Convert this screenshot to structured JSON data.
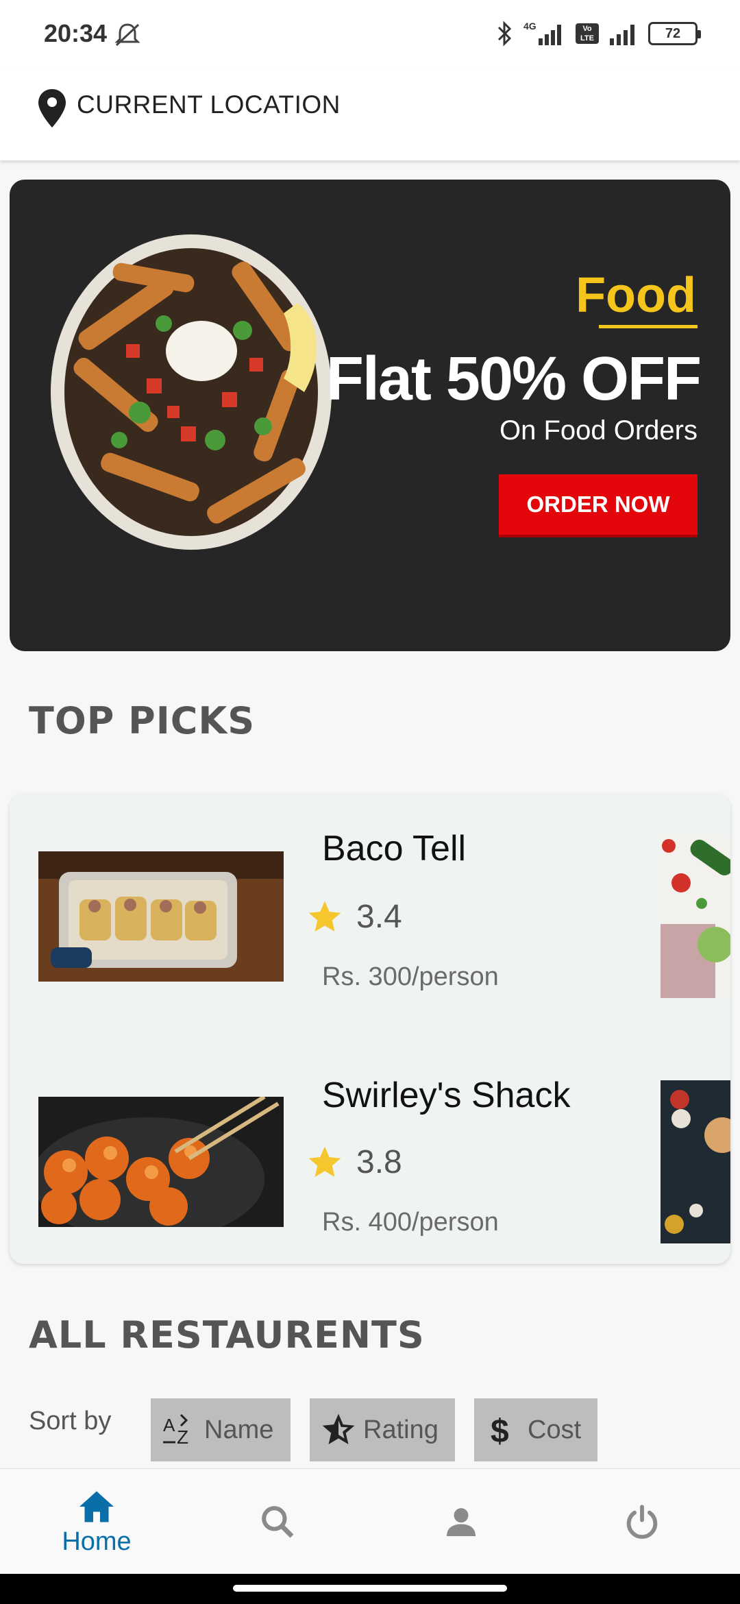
{
  "status_bar": {
    "time": "20:34",
    "network_1": "4G",
    "network_2": "Vo LTE",
    "battery": "72"
  },
  "header": {
    "location_label": "CURRENT LOCATION"
  },
  "banner": {
    "brand": "Food",
    "headline": "Flat 50% OFF",
    "subline": "On Food Orders",
    "cta": "ORDER NOW"
  },
  "top_picks": {
    "title": "TOP PICKS",
    "items": [
      {
        "name": "Baco Tell",
        "rating": "3.4",
        "cost": "Rs. 300/person"
      },
      {
        "name": "Swirley's Shack",
        "rating": "3.8",
        "cost": "Rs. 400/person"
      }
    ]
  },
  "all_restaurants": {
    "title": "ALL RESTAURENTS",
    "sort_label": "Sort by",
    "sort_options": [
      {
        "label": "Name",
        "icon": "sort-alpha-icon"
      },
      {
        "label": "Rating",
        "icon": "star-outline-icon"
      },
      {
        "label": "Cost",
        "icon": "dollar-icon"
      }
    ]
  },
  "nav": {
    "home_label": "Home",
    "active": "home",
    "accent_color": "#0a6fa8",
    "inactive_color": "#8a8a8a"
  }
}
